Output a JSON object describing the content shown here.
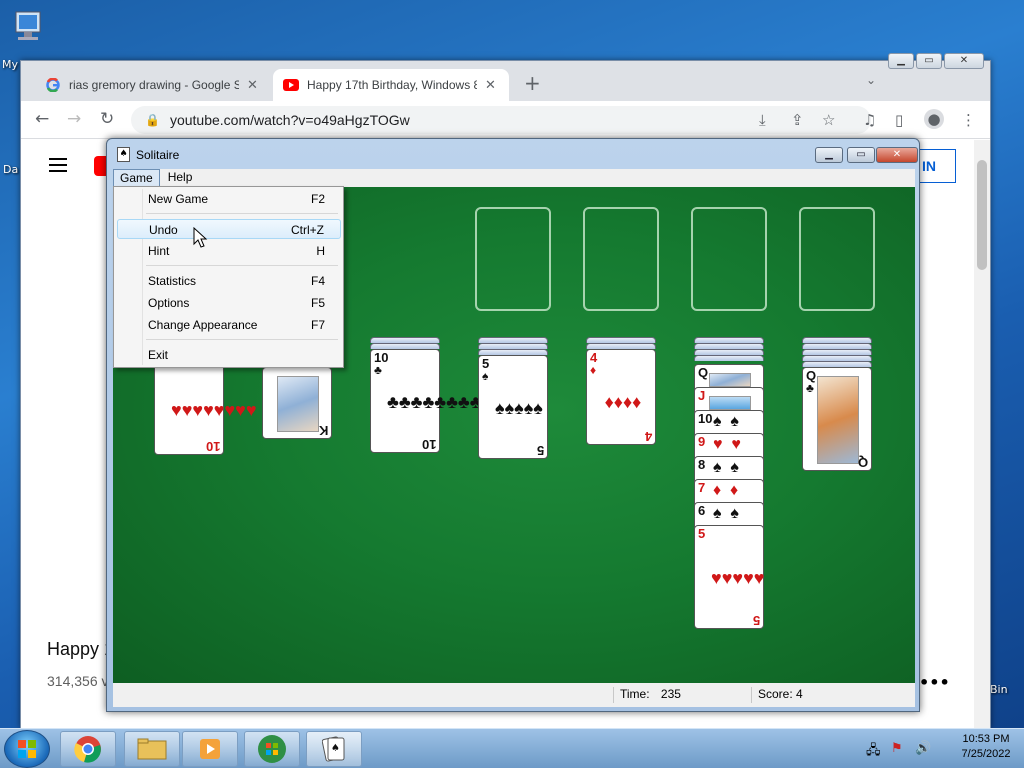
{
  "desktop": {
    "icon1_label": "My",
    "icon2_label": "Da",
    "recycle_label": "Bin"
  },
  "browser": {
    "tabs": [
      {
        "title": "rias gremory drawing - Google S",
        "favicon": "google-icon"
      },
      {
        "title": "Happy 17th Birthday, Windows 8",
        "favicon": "youtube-icon"
      }
    ],
    "new_tab": "+",
    "url": "youtube.com/watch?v=o49aHgzTOGw",
    "signin": "IN",
    "video_title": "Happy 1",
    "views": "314,356 v"
  },
  "solitaire": {
    "title": "Solitaire",
    "menus": [
      "Game",
      "Help"
    ],
    "game_menu": [
      {
        "label": "New Game",
        "key": "F2"
      },
      {
        "label": "Undo",
        "key": "Ctrl+Z"
      },
      {
        "label": "Hint",
        "key": "H"
      },
      {
        "label": "Statistics",
        "key": "F4"
      },
      {
        "label": "Options",
        "key": "F5"
      },
      {
        "label": "Change Appearance",
        "key": "F7"
      },
      {
        "label": "Exit",
        "key": ""
      }
    ],
    "status": {
      "time_label": "Time:",
      "time": "235",
      "score_label": "Score:",
      "score": "4"
    },
    "cards": {
      "c1": {
        "rank": "10",
        "suit": "♥"
      },
      "c2": {
        "rank": "K",
        "suit": "♠"
      },
      "c3": {
        "rank": "10",
        "suit": "♣"
      },
      "c4": {
        "rank": "5",
        "suit": "♠"
      },
      "c5": {
        "rank": "4",
        "suit": "♦"
      },
      "col6": [
        {
          "rank": "Q",
          "suit": ""
        },
        {
          "rank": "J",
          "suit": ""
        },
        {
          "rank": "10",
          "suit": "♠"
        },
        {
          "rank": "9",
          "suit": "♥"
        },
        {
          "rank": "8",
          "suit": "♠"
        },
        {
          "rank": "7",
          "suit": "♦"
        },
        {
          "rank": "6",
          "suit": "♠"
        },
        {
          "rank": "5",
          "suit": "♥"
        }
      ],
      "c7": {
        "rank": "Q",
        "suit": "♣"
      }
    }
  },
  "taskbar": {
    "time": "10:53 PM",
    "date": "7/25/2022"
  }
}
